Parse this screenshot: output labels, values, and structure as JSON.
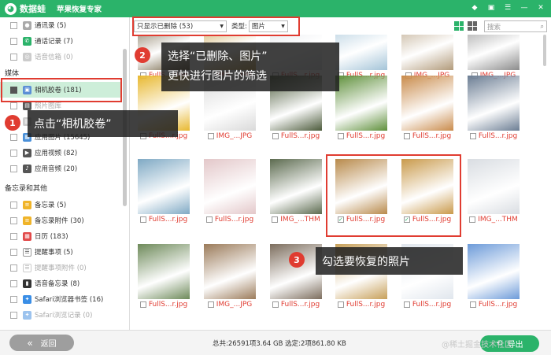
{
  "app": {
    "logo_text": "数据蛙",
    "title": "苹果恢复专家",
    "brand_color": "#2bb36a"
  },
  "titlebar_icons": [
    "diamond-icon",
    "gift-icon",
    "menu-icon",
    "minimize-icon",
    "close-icon"
  ],
  "sidebar": {
    "rows_top": [
      {
        "label": "通讯录 (5)",
        "icon": "contacts-icon",
        "disabled": false
      },
      {
        "label": "通话记录 (7)",
        "icon": "phone-icon",
        "disabled": false
      },
      {
        "label": "语音信箱 (0)",
        "icon": "voicemail-icon",
        "disabled": true
      }
    ],
    "section_media": "媒体",
    "rows_media": [
      {
        "label": "相机胶卷 (181)",
        "icon": "camera-roll-icon",
        "disabled": false,
        "selected": true
      },
      {
        "label": "照片图库",
        "icon": "photo-library-icon",
        "disabled": true
      },
      {
        "label": "",
        "icon": "photo-stream-icon",
        "disabled": true
      },
      {
        "label": "应用图片 (15645)",
        "icon": "app-photos-icon",
        "disabled": false
      },
      {
        "label": "应用视频 (82)",
        "icon": "app-video-icon",
        "disabled": false
      },
      {
        "label": "应用音频 (20)",
        "icon": "app-audio-icon",
        "disabled": false
      }
    ],
    "section_memo": "备忘录和其他",
    "rows_memo": [
      {
        "label": "备忘录 (5)",
        "icon": "notes-icon",
        "disabled": false
      },
      {
        "label": "备忘录附件 (30)",
        "icon": "notes-attachment-icon",
        "disabled": false
      },
      {
        "label": "日历 (183)",
        "icon": "calendar-icon",
        "disabled": false
      },
      {
        "label": "提醒事项 (5)",
        "icon": "reminders-icon",
        "disabled": false
      },
      {
        "label": "提醒事项附件 (0)",
        "icon": "reminders-attachment-icon",
        "disabled": true
      },
      {
        "label": "语音备忘录 (8)",
        "icon": "voice-memo-icon",
        "disabled": false
      },
      {
        "label": "Safari浏览器书签 (16)",
        "icon": "safari-bookmark-icon",
        "disabled": false
      },
      {
        "label": "Safari浏览记录 (0)",
        "icon": "safari-history-icon",
        "disabled": true
      }
    ]
  },
  "filter": {
    "show_select": "只显示已删除 (53)",
    "type_label": "类型:",
    "type_select": "图片",
    "search_placeholder": "搜索"
  },
  "grid": {
    "row_captions": [
      [
        "FullS...r.jpg",
        "IMG_...JPG",
        "FullS...r.jpg",
        "FullS...r.jpg",
        "IMG_...JPG",
        "IMG_...JPG"
      ],
      [
        "FullS...r.jpg",
        "IMG_...JPG",
        "FullS...r.jpg",
        "FullS...r.jpg",
        "FullS...r.jpg",
        "FullS...r.jpg"
      ],
      [
        "FullS...r.jpg",
        "FullS...r.jpg",
        "IMG_...THM",
        "FullS...r.jpg",
        "FullS...r.jpg",
        "IMG_...THM"
      ],
      [
        "FullS...r.jpg",
        "IMG_...JPG",
        "FullS...r.jpg",
        "FullS...r.jpg",
        "FullS...r.jpg",
        "FullS...r.jpg"
      ]
    ],
    "checked": [
      [
        false,
        false,
        false,
        false,
        false,
        false
      ],
      [
        false,
        false,
        false,
        false,
        false,
        false
      ],
      [
        false,
        false,
        false,
        true,
        true,
        false
      ],
      [
        false,
        false,
        false,
        false,
        false,
        false
      ]
    ]
  },
  "callouts": {
    "c1_num": "1",
    "c1_text": "点击“相机胶卷”",
    "c2_num": "2",
    "c2_line1": "选择“已删除、图片”",
    "c2_line2": "更快进行图片的筛选",
    "c3_num": "3",
    "c3_text": "勾选要恢复的照片",
    "accent_color": "#e03c31"
  },
  "bottom": {
    "back": "返回",
    "status": "总共:26591项3.64 GB 选定:2项861.80 KB",
    "export": "导出",
    "watermark": "@稀土掘金技术社区"
  }
}
